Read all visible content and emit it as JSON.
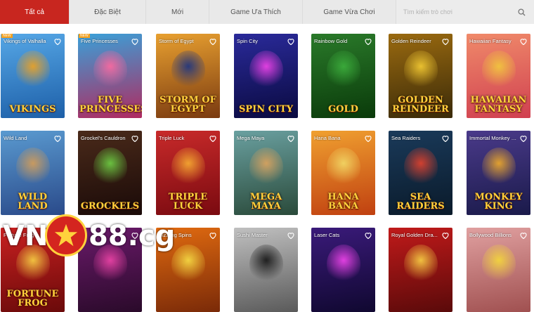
{
  "tabs": [
    {
      "label": "Tất cả",
      "active": true
    },
    {
      "label": "Đặc Biệt",
      "active": false
    },
    {
      "label": "Mới",
      "active": false
    },
    {
      "label": "Game Ưa Thích",
      "active": false
    },
    {
      "label": "Game Vừa Chơi",
      "active": false
    }
  ],
  "search": {
    "placeholder": "Tìm kiếm trò chơi"
  },
  "games": [
    {
      "name": "Vikings of Valhalla",
      "badge": "NEW",
      "logo": "VIKINGS",
      "colors": [
        "#56a7e6",
        "#1d5fa8"
      ],
      "accent": "#e0a030"
    },
    {
      "name": "Five Princesses",
      "badge": "NEW",
      "logo": "FIVE PRINCESSES",
      "colors": [
        "#3aa0d8",
        "#b02a60"
      ],
      "accent": "#f06aa0"
    },
    {
      "name": "Storm of Egypt",
      "badge": "",
      "logo": "STORM OF EGYPT",
      "colors": [
        "#e8a030",
        "#7a3a10"
      ],
      "accent": "#2a3a7a"
    },
    {
      "name": "Spin City",
      "badge": "",
      "logo": "SPIN CITY",
      "colors": [
        "#2a2a9a",
        "#0a0a40"
      ],
      "accent": "#e040e0"
    },
    {
      "name": "Rainbow Gold",
      "badge": "",
      "logo": "GOLD",
      "colors": [
        "#2a7a2a",
        "#0a3a0a"
      ],
      "accent": "#3aa83a"
    },
    {
      "name": "Golden Reindeer",
      "badge": "",
      "logo": "GOLDEN REINDEER",
      "colors": [
        "#9a6a10",
        "#3a2a08"
      ],
      "accent": "#e8c030"
    },
    {
      "name": "Hawaiian Fantasy",
      "badge": "",
      "logo": "HAWAIIAN FANTASY",
      "colors": [
        "#f08a6a",
        "#d04050"
      ],
      "accent": "#f0c040"
    },
    {
      "name": "Wild Land",
      "badge": "",
      "logo": "WILD LAND",
      "colors": [
        "#5a9ad0",
        "#2a4a8a"
      ],
      "accent": "#c89a60"
    },
    {
      "name": "Grockel's Cauldron",
      "badge": "",
      "logo": "GROCKELS",
      "colors": [
        "#4a2a1a",
        "#1a0a08"
      ],
      "accent": "#6ac040"
    },
    {
      "name": "Triple Luck",
      "badge": "",
      "logo": "TRIPLE LUCK",
      "colors": [
        "#c82a2a",
        "#7a0a10"
      ],
      "accent": "#f0a030"
    },
    {
      "name": "Mega Maya",
      "badge": "",
      "logo": "MEGA MAYA",
      "colors": [
        "#6aa0a0",
        "#2a4a3a"
      ],
      "accent": "#d0a060"
    },
    {
      "name": "Hana Bana",
      "badge": "",
      "logo": "HANA BANA",
      "colors": [
        "#f0a030",
        "#c04010"
      ],
      "accent": "#f0d060"
    },
    {
      "name": "Sea Raiders",
      "badge": "",
      "logo": "SEA RAIDERS",
      "colors": [
        "#1a3a5a",
        "#0a1a2a"
      ],
      "accent": "#d04030"
    },
    {
      "name": "Immortal Monkey King",
      "badge": "",
      "logo": "MONKEY KING",
      "colors": [
        "#4a3a8a",
        "#1a1a4a"
      ],
      "accent": "#e0a030"
    },
    {
      "name": "Fortune Frog",
      "badge": "",
      "logo": "FORTUNE FROG",
      "colors": [
        "#c82020",
        "#6a0a0a"
      ],
      "accent": "#f0c040"
    },
    {
      "name": "",
      "badge": "",
      "logo": "",
      "colors": [
        "#6a1a6a",
        "#2a0a2a"
      ],
      "accent": "#e040a0"
    },
    {
      "name": "Sizzling Spins",
      "badge": "",
      "logo": "",
      "colors": [
        "#e06a10",
        "#7a2a08"
      ],
      "accent": "#f0d040"
    },
    {
      "name": "Sushi Master",
      "badge": "",
      "logo": "",
      "colors": [
        "#c0c0c0",
        "#5a5a5a"
      ],
      "accent": "#202020"
    },
    {
      "name": "Laser Cats",
      "badge": "",
      "logo": "",
      "colors": [
        "#3a1a7a",
        "#100830"
      ],
      "accent": "#e040e0"
    },
    {
      "name": "Royal Golden Dra...",
      "badge": "",
      "logo": "",
      "colors": [
        "#c01a1a",
        "#5a0a0a"
      ],
      "accent": "#f0c040"
    },
    {
      "name": "Bollywood Billions",
      "badge": "",
      "logo": "",
      "colors": [
        "#e0a0a0",
        "#a05050"
      ],
      "accent": "#f0d040"
    }
  ],
  "watermark": {
    "text_left": "VN",
    "text_right": "88.cg"
  }
}
